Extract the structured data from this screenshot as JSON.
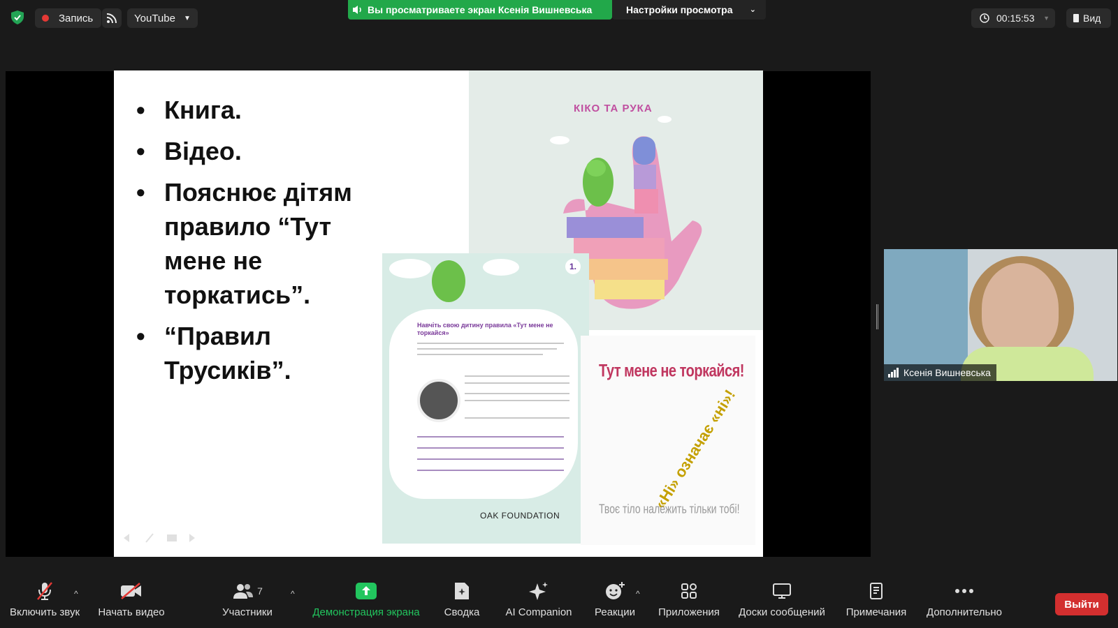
{
  "topbar": {
    "record_label": "Запись",
    "stream_label": "YouTube",
    "share_banner": "Вы просматриваете экран Ксенія Вишневська",
    "view_settings": "Настройки просмотра",
    "timer": "00:15:53",
    "view_label": "Вид"
  },
  "slide": {
    "bullets": [
      "Книга.",
      "Відео.",
      "Пояснює дітям правило “Тут мене не торкатись”.",
      "“Правил Трусиків”."
    ],
    "cover_title": "КІКО ТА РУКА",
    "leaflet_page": "1.",
    "leaflet_heading": "Навчіть свою дитину правила «Тут мене не торкайся»",
    "leaflet_logo": "OAK FOUNDATION",
    "poster_title": "Тут мене не торкайся!",
    "poster_diagonal": "«Ні» означає «ні»!",
    "poster_bottom": "Твоє тіло належить тільки тобі!"
  },
  "participant": {
    "name": "Ксенія Вишневська"
  },
  "toolbar": {
    "mic": "Включить звук",
    "video": "Начать видео",
    "participants": "Участники",
    "participants_count": "7",
    "share": "Демонстрация экрана",
    "summary": "Сводка",
    "ai": "AI Companion",
    "reactions": "Реакции",
    "apps": "Приложения",
    "whiteboards": "Доски сообщений",
    "notes": "Примечания",
    "more": "Дополнительно",
    "leave": "Выйти"
  },
  "colors": {
    "accent_green": "#22a84a",
    "leave_red": "#d32f2f",
    "background": "#1a1a1a"
  }
}
